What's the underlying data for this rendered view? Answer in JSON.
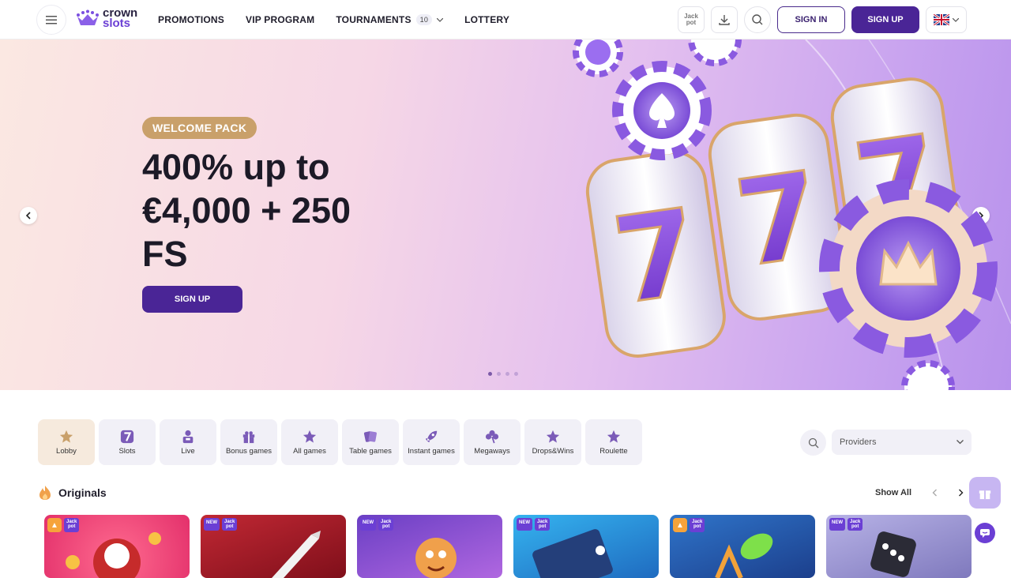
{
  "header": {
    "logo_line1": "crown",
    "logo_line2": "slots",
    "nav": [
      {
        "label": "PROMOTIONS"
      },
      {
        "label": "VIP PROGRAM"
      },
      {
        "label": "TOURNAMENTS",
        "count": "10"
      },
      {
        "label": "LOTTERY"
      }
    ],
    "jackpot_line1": "Jack",
    "jackpot_line2": "pot",
    "signin_label": "SIGN IN",
    "signup_label": "SIGN UP"
  },
  "hero": {
    "badge": "WELCOME PACK",
    "title": "400% up to €4,000 + 250 FS",
    "cta": "SIGN UP",
    "slides": 4,
    "active_slide": 1
  },
  "categories": [
    {
      "label": "Lobby",
      "icon": "star-icon",
      "active": true
    },
    {
      "label": "Slots",
      "icon": "seven-icon"
    },
    {
      "label": "Live",
      "icon": "dealer-icon"
    },
    {
      "label": "Bonus games",
      "icon": "gift-icon"
    },
    {
      "label": "All games",
      "icon": "star-icon"
    },
    {
      "label": "Table games",
      "icon": "cards-icon"
    },
    {
      "label": "Instant games",
      "icon": "rocket-icon"
    },
    {
      "label": "Megaways",
      "icon": "clover-icon"
    },
    {
      "label": "Drops&Wins",
      "icon": "star-icon"
    },
    {
      "label": "Roulette",
      "icon": "star-icon"
    }
  ],
  "providers_placeholder": "Providers",
  "originals": {
    "title": "Originals",
    "show_all": "Show All",
    "games": [
      {
        "tags": [
          "fire",
          "jackpot"
        ],
        "bg": "#e8366f"
      },
      {
        "tags": [
          "new",
          "jackpot"
        ],
        "bg": "#b0232d"
      },
      {
        "tags": [
          "new",
          "jackpot"
        ],
        "bg": "#8a4fd6"
      },
      {
        "tags": [
          "new",
          "jackpot"
        ],
        "bg": "#2c8fd8"
      },
      {
        "tags": [
          "fire",
          "jackpot"
        ],
        "bg": "#2a6fc2"
      },
      {
        "tags": [
          "new",
          "jackpot"
        ],
        "bg": "#8a86c8"
      }
    ]
  },
  "colors": {
    "accent": "#4a2596",
    "badge": "#c9a06a"
  }
}
